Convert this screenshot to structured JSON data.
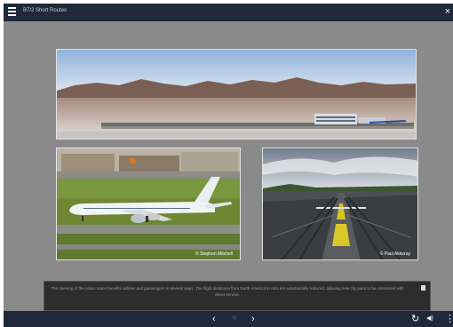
{
  "app": {
    "title": "B7/2 Short Routes"
  },
  "icons": {
    "menu": "hamburger-menu-icon",
    "close": "close-icon",
    "prev": "chevron-left-icon",
    "pause": "pause-icon",
    "next": "chevron-right-icon",
    "replay": "replay-icon",
    "volume": "volume-icon",
    "more": "more-vertical-icon",
    "doc": "document-icon"
  },
  "labels": {
    "close": "×",
    "prev": "‹",
    "pause": "II",
    "next": "›",
    "replay": "↻",
    "volume": "◀)",
    "more": "⋮"
  },
  "images": {
    "airport_panorama": {
      "credit": ""
    },
    "aircraft_taxiing": {
      "credit": "© Stephen Mitchell"
    },
    "runway_view": {
      "credit": "© Paul Akkeray"
    }
  },
  "caption": {
    "text": "The opening of the polar routes benefits airlines and passengers in several ways. The flight distances from North America to Asia are substantially reduced, allowing new city pairs to be connected with direct service."
  },
  "colors": {
    "titlebar": "#1e2a3a",
    "background": "#8a8a8a",
    "caption_bg": "#2d2d2d"
  }
}
